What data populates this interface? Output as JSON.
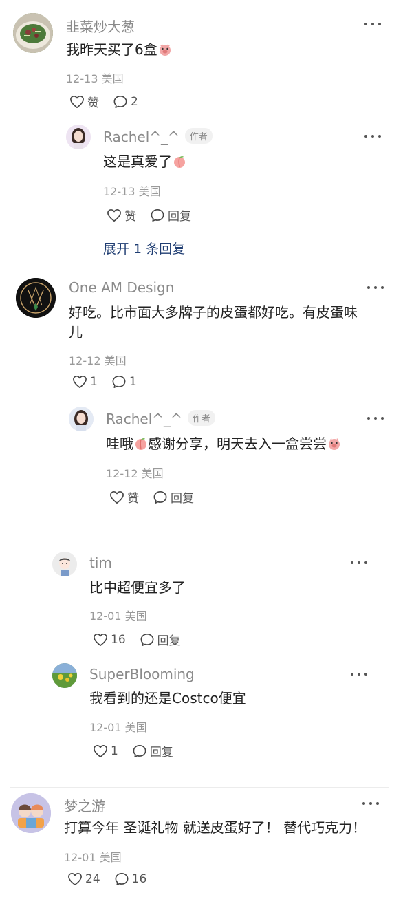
{
  "colors": {
    "name": "#8a8a8a",
    "meta": "#9a9a9a",
    "link": "#1f3d72",
    "divider": "#ececec"
  },
  "icons": {
    "like": "heart-outline-icon",
    "reply": "speech-bubble-icon",
    "more": "three-dots-icon"
  },
  "c1": {
    "name": "韭菜炒大葱",
    "text": "我昨天买了6盒",
    "date": "12-13",
    "location": "美国",
    "like": "赞",
    "reply": "2",
    "reply1": {
      "name": "Rachel^_^",
      "tag": "作者",
      "text": "这是真爱了",
      "date": "12-13",
      "location": "美国",
      "like": "赞",
      "reply": "回复"
    },
    "expand": "展开 1 条回复"
  },
  "c2": {
    "name": "One AM Design",
    "text_line1": "好吃。比市面大多牌子的皮蛋都好吃。有皮蛋味",
    "text_line2": "儿",
    "date": "12-12",
    "location": "美国",
    "like": "1",
    "reply": "1",
    "reply1": {
      "name": "Rachel^_^",
      "tag": "作者",
      "text_a": "哇哦",
      "text_b": "感谢分享，明天去入一盒尝尝",
      "date": "12-12",
      "location": "美国",
      "like": "赞",
      "reply": "回复"
    }
  },
  "c3": {
    "reply_tim": {
      "name": "tim",
      "text": "比中超便宜多了",
      "date": "12-01",
      "location": "美国",
      "like": "16",
      "reply": "回复"
    },
    "reply_sb": {
      "name": "SuperBlooming",
      "text": "我看到的还是Costco便宜",
      "date": "12-01",
      "location": "美国",
      "like": "1",
      "reply": "回复"
    }
  },
  "c4": {
    "name": "梦之游",
    "text": "打算今年 圣诞礼物 就送皮蛋好了！ 替代巧克力！",
    "date": "12-01",
    "location": "美国",
    "like": "24",
    "reply": "16"
  }
}
